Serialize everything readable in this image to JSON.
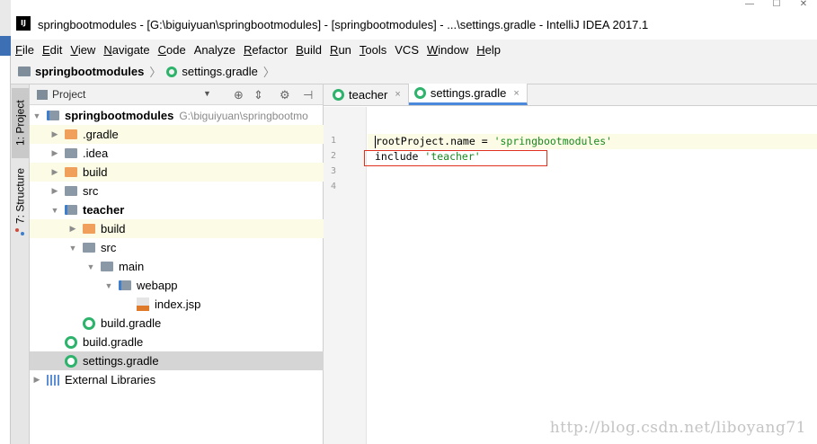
{
  "window": {
    "title": "springbootmodules - [G:\\biguiyuan\\springbootmodules] - [springbootmodules] - ...\\settings.gradle - IntelliJ IDEA 2017.1",
    "app_icon_label": "IJ"
  },
  "menu": {
    "items": [
      {
        "label": "File",
        "mnemonic": "F",
        "rest": "ile"
      },
      {
        "label": "Edit",
        "mnemonic": "E",
        "rest": "dit"
      },
      {
        "label": "View",
        "mnemonic": "V",
        "rest": "iew"
      },
      {
        "label": "Navigate",
        "mnemonic": "N",
        "rest": "avigate"
      },
      {
        "label": "Code",
        "mnemonic": "C",
        "rest": "ode"
      },
      {
        "label": "Analyze",
        "mnemonic": "",
        "rest": "Analyze"
      },
      {
        "label": "Refactor",
        "mnemonic": "R",
        "rest": "efactor"
      },
      {
        "label": "Build",
        "mnemonic": "B",
        "rest": "uild"
      },
      {
        "label": "Run",
        "mnemonic": "R",
        "rest": "un"
      },
      {
        "label": "Tools",
        "mnemonic": "T",
        "rest": "ools"
      },
      {
        "label": "VCS",
        "mnemonic": "",
        "rest": "VCS"
      },
      {
        "label": "Window",
        "mnemonic": "W",
        "rest": "indow"
      },
      {
        "label": "Help",
        "mnemonic": "H",
        "rest": "elp"
      }
    ]
  },
  "breadcrumb": {
    "root": "springbootmodules",
    "file": "settings.gradle",
    "separator": "〉"
  },
  "side_tabs": {
    "project": "1: Project",
    "structure": "7: Structure"
  },
  "project_panel": {
    "title": "Project",
    "dropdown_glyph": "▼"
  },
  "tree": [
    {
      "label": "springbootmodules",
      "path": "G:\\biguiyuan\\springbootmo",
      "icon": "module-folder-icon",
      "arrow": "▼",
      "bold": true
    },
    {
      "label": ".gradle",
      "icon": "folder-icon",
      "arrow": "▶"
    },
    {
      "label": ".idea",
      "icon": "folder-icon",
      "arrow": "▶"
    },
    {
      "label": "build",
      "icon": "excluded-folder-icon",
      "arrow": "▶"
    },
    {
      "label": "src",
      "icon": "folder-icon",
      "arrow": "▶"
    },
    {
      "label": "teacher",
      "icon": "module-folder-icon",
      "arrow": "▼",
      "bold": true
    },
    {
      "label": "build",
      "icon": "excluded-folder-icon",
      "arrow": "▶"
    },
    {
      "label": "src",
      "icon": "folder-icon",
      "arrow": "▼"
    },
    {
      "label": "main",
      "icon": "folder-icon",
      "arrow": "▼"
    },
    {
      "label": "webapp",
      "icon": "web-folder-icon",
      "arrow": "▼"
    },
    {
      "label": "index.jsp",
      "icon": "jsp-file-icon",
      "arrow": ""
    },
    {
      "label": "build.gradle",
      "icon": "gradle-file-icon",
      "arrow": ""
    },
    {
      "label": "build.gradle",
      "icon": "gradle-file-icon",
      "arrow": ""
    },
    {
      "label": "settings.gradle",
      "icon": "gradle-file-icon",
      "arrow": "",
      "selected": true
    },
    {
      "label": "External Libraries",
      "icon": "library-icon",
      "arrow": "▶"
    }
  ],
  "editor_tabs": [
    {
      "label": "teacher",
      "active": false,
      "close": "×"
    },
    {
      "label": "settings.gradle",
      "active": true,
      "close": "×"
    }
  ],
  "code": {
    "line_numbers": [
      "1",
      "2",
      "3",
      "4"
    ],
    "lines": [
      {
        "pre": "rootProject.name = ",
        "str": "'springbootmodules'"
      },
      {
        "pre": "include ",
        "str": "'teacher'"
      },
      {
        "pre": "",
        "str": ""
      },
      {
        "pre": "",
        "str": ""
      }
    ]
  },
  "watermark": "http://blog.csdn.net/liboyang71",
  "colors": {
    "gradle_green": "#2db36b",
    "excluded_orange": "#f0a05a",
    "string_green": "#188a1e",
    "highlight_box": "#e0301e",
    "tab_underline": "#4a89dc"
  }
}
